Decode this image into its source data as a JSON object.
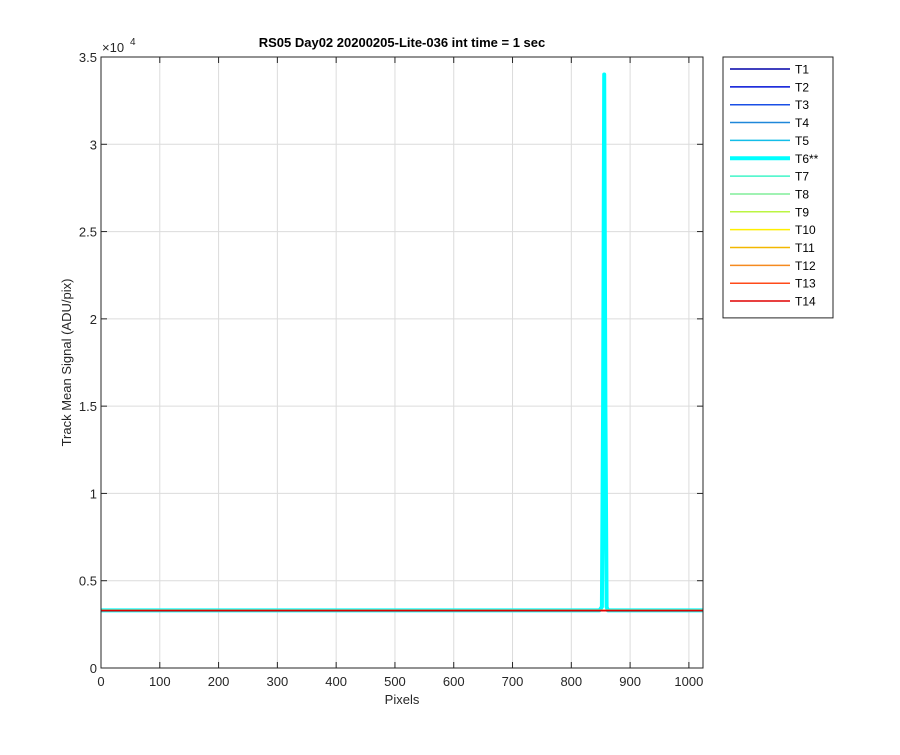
{
  "chart_data": {
    "type": "line",
    "title": "RS05 Day02 20200205-Lite-036 int time = 1 sec",
    "xlabel": "Pixels",
    "ylabel": "Track Mean Signal (ADU/pix)",
    "xlim": [
      0,
      1024
    ],
    "ylim": [
      0,
      35000
    ],
    "y_exponent_label": "×10",
    "y_exponent_power": "4",
    "x_ticks": [
      0,
      100,
      200,
      300,
      400,
      500,
      600,
      700,
      800,
      900,
      1000
    ],
    "x_tick_labels": [
      "0",
      "100",
      "200",
      "300",
      "400",
      "500",
      "600",
      "700",
      "800",
      "900",
      "1000"
    ],
    "y_ticks": [
      0,
      5000,
      10000,
      15000,
      20000,
      25000,
      30000,
      35000
    ],
    "y_tick_labels": [
      "0",
      "0.5",
      "1",
      "1.5",
      "2",
      "2.5",
      "3",
      "3.5"
    ],
    "grid": true,
    "legend_position": "outside-right-top",
    "series": [
      {
        "name": "T1",
        "color": "#0000a8",
        "width": 1.5,
        "x": [
          0,
          1024
        ],
        "y": [
          3300,
          3300
        ]
      },
      {
        "name": "T2",
        "color": "#0010d6",
        "width": 1.5,
        "x": [
          0,
          1024
        ],
        "y": [
          3300,
          3300
        ]
      },
      {
        "name": "T3",
        "color": "#1a4fe6",
        "width": 1.5,
        "x": [
          0,
          1024
        ],
        "y": [
          3300,
          3300
        ]
      },
      {
        "name": "T4",
        "color": "#1f87d9",
        "width": 1.5,
        "x": [
          0,
          1024
        ],
        "y": [
          3300,
          3300
        ]
      },
      {
        "name": "T5",
        "color": "#13bde8",
        "width": 1.5,
        "x": [
          0,
          1024
        ],
        "y": [
          3300,
          3300
        ]
      },
      {
        "name": "T6**",
        "color": "#00ffff",
        "width": 4,
        "x": [
          0,
          848,
          852,
          854,
          856,
          858,
          860,
          862,
          866,
          1024
        ],
        "y": [
          3300,
          3300,
          3500,
          15000,
          34000,
          15000,
          3500,
          3300,
          3300,
          3300
        ]
      },
      {
        "name": "T7",
        "color": "#41f5c8",
        "width": 1.5,
        "x": [
          0,
          1024
        ],
        "y": [
          3300,
          3300
        ]
      },
      {
        "name": "T8",
        "color": "#80ee9a",
        "width": 1.5,
        "x": [
          0,
          1024
        ],
        "y": [
          3300,
          3300
        ]
      },
      {
        "name": "T9",
        "color": "#bbf542",
        "width": 1.5,
        "x": [
          0,
          1024
        ],
        "y": [
          3300,
          3300
        ]
      },
      {
        "name": "T10",
        "color": "#ffef00",
        "width": 1.5,
        "x": [
          0,
          1024
        ],
        "y": [
          3300,
          3300
        ]
      },
      {
        "name": "T11",
        "color": "#f2b700",
        "width": 1.5,
        "x": [
          0,
          1024
        ],
        "y": [
          3300,
          3300
        ]
      },
      {
        "name": "T12",
        "color": "#f58a1f",
        "width": 1.5,
        "x": [
          0,
          1024
        ],
        "y": [
          3300,
          3300
        ]
      },
      {
        "name": "T13",
        "color": "#ff4a1a",
        "width": 1.5,
        "x": [
          0,
          1024
        ],
        "y": [
          3300,
          3300
        ]
      },
      {
        "name": "T14",
        "color": "#e00000",
        "width": 1.5,
        "x": [
          0,
          1024
        ],
        "y": [
          3280,
          3280
        ]
      }
    ]
  }
}
